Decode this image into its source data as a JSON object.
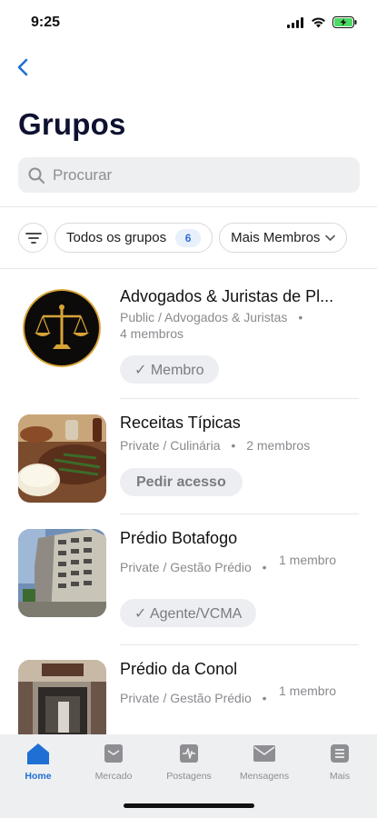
{
  "status": {
    "time": "9:25"
  },
  "header": {
    "title": "Grupos"
  },
  "search": {
    "placeholder": "Procurar"
  },
  "filters": {
    "all_groups_label": "Todos os grupos",
    "all_groups_count": "6",
    "sort_label": "Mais Membros"
  },
  "groups": [
    {
      "name": "Advogados & Juristas de Pl...",
      "meta_line1": "Public / Advogados & Juristas",
      "meta_line2": "4 membros",
      "action": "✓ Membro"
    },
    {
      "name": "Receitas Típicas",
      "meta_line1": "Private / Culinária",
      "meta_members": "2 membros",
      "action": "Pedir acesso"
    },
    {
      "name": "Prédio Botafogo",
      "meta_line1": "Private / Gestão Prédio",
      "meta_members": "1 membro",
      "action": "✓ Agente/VCMA"
    },
    {
      "name": "Prédio da Conol",
      "meta_line1": "Private / Gestão Prédio",
      "meta_members": "1 membro"
    }
  ],
  "tabs": [
    {
      "label": "Home",
      "icon": "home-icon",
      "active": true
    },
    {
      "label": "Mercado",
      "icon": "store-icon"
    },
    {
      "label": "Postagens",
      "icon": "activity-icon"
    },
    {
      "label": "Mensagens",
      "icon": "mail-icon"
    },
    {
      "label": "Mais",
      "icon": "list-icon"
    }
  ],
  "colors": {
    "accent": "#1f6fd4",
    "title": "#0e1230",
    "battery": "#4cd964"
  }
}
